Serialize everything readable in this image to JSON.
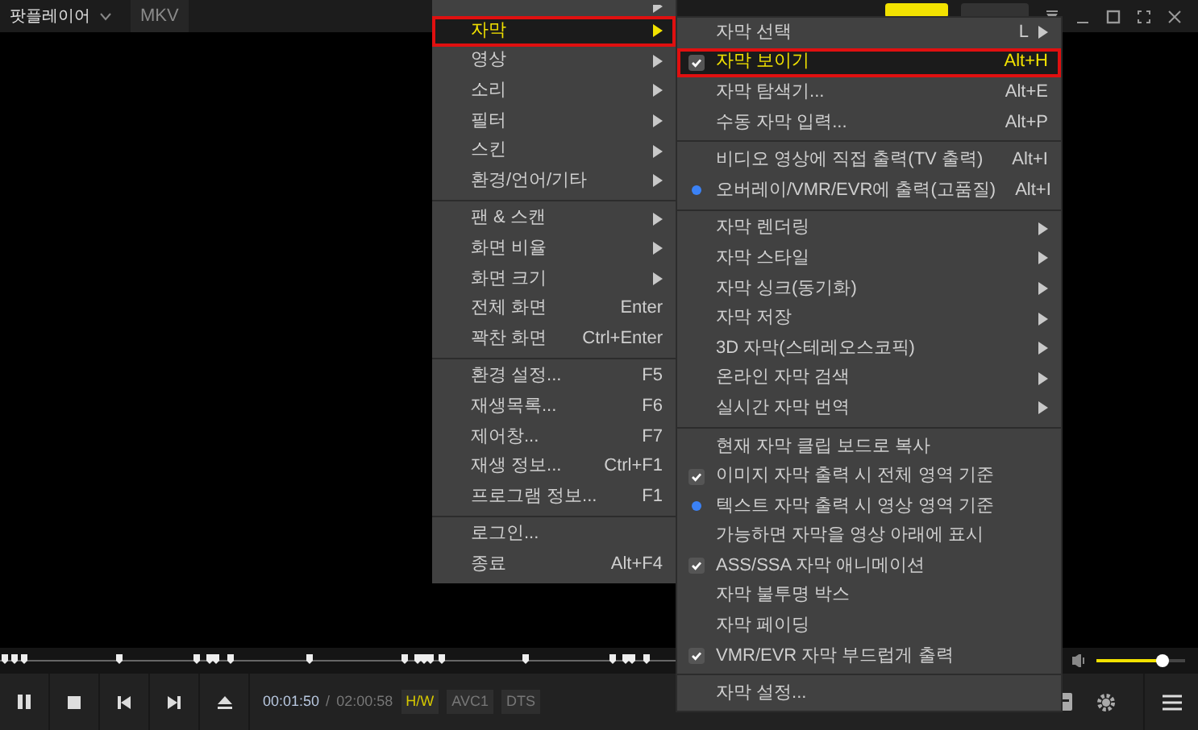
{
  "title_bar": {
    "app_name": "팟플레이어",
    "format": "MKV"
  },
  "main_menu": [
    {
      "kind": "submenu",
      "label": "자막",
      "selected": true
    },
    {
      "kind": "submenu",
      "label": "영상",
      "selected": false
    },
    {
      "kind": "submenu",
      "label": "소리",
      "selected": false
    },
    {
      "kind": "submenu",
      "label": "필터",
      "selected": false
    },
    {
      "kind": "submenu",
      "label": "스킨",
      "selected": false
    },
    {
      "kind": "submenu",
      "label": "환경/언어/기타",
      "selected": false
    },
    {
      "kind": "separator"
    },
    {
      "kind": "submenu",
      "label": "팬 & 스캔",
      "selected": false
    },
    {
      "kind": "submenu",
      "label": "화면 비율",
      "selected": false
    },
    {
      "kind": "submenu",
      "label": "화면 크기",
      "selected": false
    },
    {
      "kind": "plain",
      "label": "전체 화면",
      "shortcut": "Enter",
      "selected": false
    },
    {
      "kind": "plain",
      "label": "꽉찬 화면",
      "shortcut": "Ctrl+Enter",
      "selected": false
    },
    {
      "kind": "separator"
    },
    {
      "kind": "plain",
      "label": "환경 설정...",
      "shortcut": "F5",
      "selected": false
    },
    {
      "kind": "plain",
      "label": "재생목록...",
      "shortcut": "F6",
      "selected": false
    },
    {
      "kind": "plain",
      "label": "제어창...",
      "shortcut": "F7",
      "selected": false
    },
    {
      "kind": "plain",
      "label": "재생 정보...",
      "shortcut": "Ctrl+F1",
      "selected": false
    },
    {
      "kind": "plain",
      "label": "프로그램 정보...",
      "shortcut": "F1",
      "selected": false
    },
    {
      "kind": "separator"
    },
    {
      "kind": "plain",
      "label": "로그인...",
      "selected": false
    },
    {
      "kind": "plain",
      "label": "종료",
      "shortcut": "Alt+F4",
      "selected": false
    }
  ],
  "subtitle_menu": [
    {
      "kind": "submenu",
      "label": "자막 선택",
      "shortcut": "L",
      "selected": false
    },
    {
      "kind": "check",
      "label": "자막 보이기",
      "shortcut": "Alt+H",
      "checked": true,
      "selected": true
    },
    {
      "kind": "plain",
      "label": "자막 탐색기...",
      "shortcut": "Alt+E",
      "selected": false
    },
    {
      "kind": "plain",
      "label": "수동 자막 입력...",
      "shortcut": "Alt+P",
      "selected": false
    },
    {
      "kind": "separator"
    },
    {
      "kind": "radio",
      "label": "비디오 영상에 직접 출력(TV 출력)",
      "shortcut": "Alt+I",
      "checked": false,
      "selected": false
    },
    {
      "kind": "radio",
      "label": "오버레이/VMR/EVR에 출력(고품질)",
      "shortcut": "Alt+I",
      "checked": true,
      "selected": false
    },
    {
      "kind": "separator"
    },
    {
      "kind": "submenu",
      "label": "자막 렌더링",
      "selected": false
    },
    {
      "kind": "submenu",
      "label": "자막 스타일",
      "selected": false
    },
    {
      "kind": "submenu",
      "label": "자막 싱크(동기화)",
      "selected": false
    },
    {
      "kind": "submenu",
      "label": "자막 저장",
      "selected": false
    },
    {
      "kind": "submenu",
      "label": "3D 자막(스테레오스코픽)",
      "selected": false
    },
    {
      "kind": "submenu",
      "label": "온라인 자막 검색",
      "selected": false
    },
    {
      "kind": "submenu",
      "label": "실시간 자막 번역",
      "selected": false
    },
    {
      "kind": "separator"
    },
    {
      "kind": "plain",
      "label": "현재 자막 클립 보드로 복사",
      "selected": false
    },
    {
      "kind": "check",
      "label": "이미지 자막 출력 시 전체 영역 기준",
      "checked": true,
      "selected": false
    },
    {
      "kind": "radio",
      "label": "텍스트 자막 출력 시 영상 영역 기준",
      "checked": true,
      "selected": false
    },
    {
      "kind": "check",
      "label": "가능하면 자막을 영상 아래에 표시",
      "checked": false,
      "selected": false
    },
    {
      "kind": "check",
      "label": "ASS/SSA 자막 애니메이션",
      "checked": true,
      "selected": false
    },
    {
      "kind": "check",
      "label": "자막 불투명 박스",
      "checked": false,
      "selected": false
    },
    {
      "kind": "check",
      "label": "자막 페이딩",
      "checked": false,
      "selected": false
    },
    {
      "kind": "check",
      "label": "VMR/EVR 자막 부드럽게 출력",
      "checked": true,
      "selected": false
    },
    {
      "kind": "separator"
    },
    {
      "kind": "plain",
      "label": "자막 설정...",
      "selected": false
    }
  ],
  "controls": {
    "current_time": "00:01:50",
    "separator": "/",
    "total_time": "02:00:58",
    "badges": [
      {
        "label": "H/W",
        "active": true
      },
      {
        "label": "AVC1",
        "active": false
      },
      {
        "label": "DTS",
        "active": false
      }
    ],
    "volume": {
      "level": 0.75
    }
  }
}
